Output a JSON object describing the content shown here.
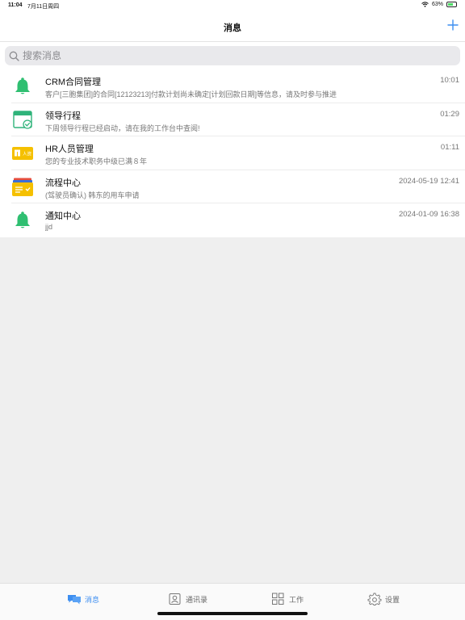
{
  "status_bar": {
    "time": "11:04",
    "date": "7月11日周四",
    "battery_percent": "63%",
    "battery_level": 0.63
  },
  "nav": {
    "title": "消息",
    "add_icon": "plus-icon"
  },
  "search": {
    "placeholder": "搜索消息",
    "value": ""
  },
  "messages": [
    {
      "title": "CRM合同管理",
      "preview": "客户[三胞集团]的合同[12123213]付款计划尚未确定[计划回款日期]等信息，请及时参与推进",
      "time": "10:01",
      "icon": "bell-icon"
    },
    {
      "title": "领导行程",
      "preview": "下周领导行程已经启动，请在我的工作台中查阅!",
      "time": "01:29",
      "icon": "calendar-check-icon"
    },
    {
      "title": "HR人员管理",
      "preview": "您的专业技术职务中级已满８年",
      "time": "01:11",
      "icon": "hr-badge-icon",
      "icon_text": "人资"
    },
    {
      "title": "流程中心",
      "preview": "(驾驶员确认) 韩东的用车申请",
      "time": "2024-05-19 12:41",
      "icon": "workflow-folder-icon"
    },
    {
      "title": "通知中心",
      "preview": "jjd",
      "time": "2024-01-09 16:38",
      "icon": "bell-icon"
    }
  ],
  "tabs": [
    {
      "label": "消息",
      "icon": "chat-bubbles-icon",
      "active": true
    },
    {
      "label": "通讯录",
      "icon": "contacts-icon",
      "active": false
    },
    {
      "label": "工作",
      "icon": "grid-icon",
      "active": false
    },
    {
      "label": "设置",
      "icon": "gear-icon",
      "active": false
    }
  ],
  "colors": {
    "accent": "#3d8ef0",
    "bell_green": "#2fbf71",
    "hr_yellow": "#f5c000",
    "background": "#efefef"
  }
}
